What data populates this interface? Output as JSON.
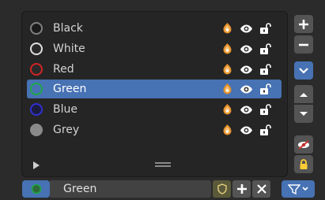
{
  "list": {
    "items": [
      {
        "label": "Black",
        "color": "#1a1a1a",
        "ring": "#808080",
        "selected": false
      },
      {
        "label": "White",
        "color": "#2a2a2a",
        "ring": "#e0e0e0",
        "selected": false
      },
      {
        "label": "Red",
        "color": "#2a2a2a",
        "ring": "#d22424",
        "selected": false
      },
      {
        "label": "Green",
        "color": "#4772b3",
        "ring": "#1fa84a",
        "selected": true
      },
      {
        "label": "Blue",
        "color": "#1b1b40",
        "ring": "#3030d0",
        "selected": false
      },
      {
        "label": "Grey",
        "color": "#8a8a8a",
        "ring": "#8a8a8a",
        "selected": false
      }
    ],
    "row_icons": [
      "onion-skin-icon",
      "eye-icon",
      "lock-open-icon"
    ]
  },
  "bottom": {
    "active_name": "Green",
    "swatch_color": "#1fa84a"
  },
  "accent": "#4772b3"
}
